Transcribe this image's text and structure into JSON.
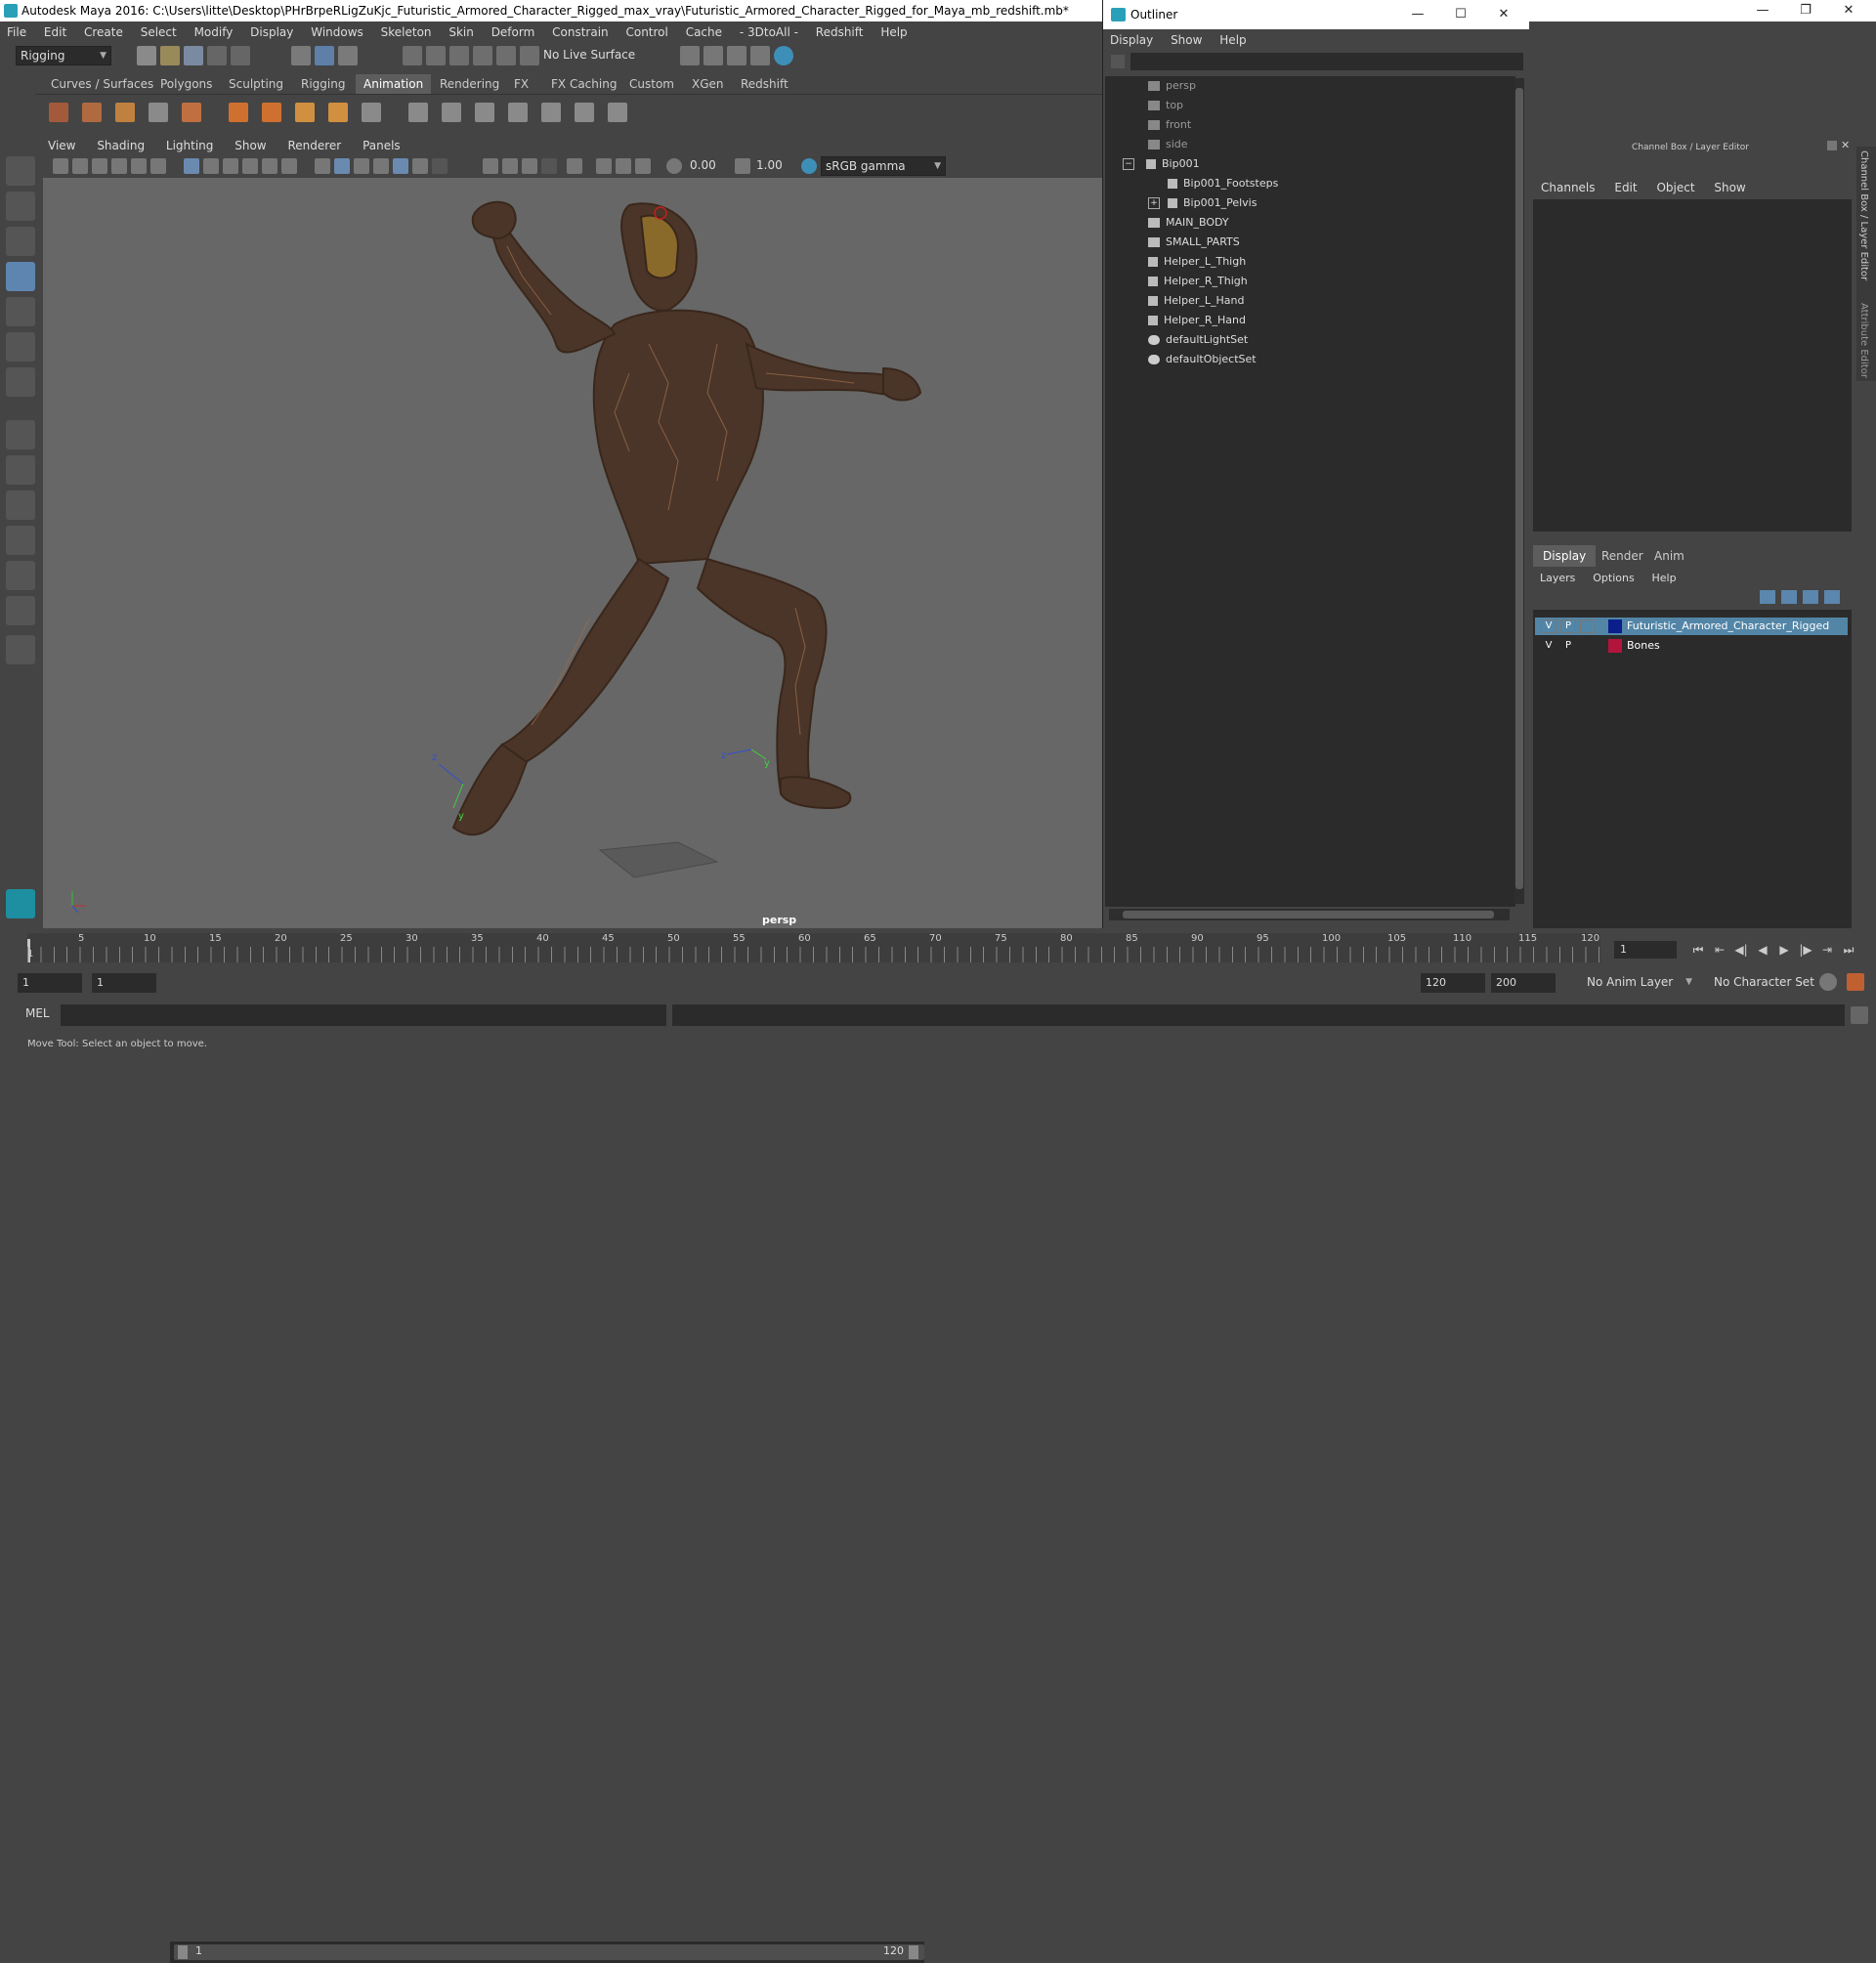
{
  "titlebar": {
    "title": "Autodesk Maya 2016: C:\\Users\\litte\\Desktop\\PHrBrpeRLigZuKjc_Futuristic_Armored_Character_Rigged_max_vray\\Futuristic_Armored_Character_Rigged_for_Maya_mb_redshift.mb*"
  },
  "menubar": [
    "File",
    "Edit",
    "Create",
    "Select",
    "Modify",
    "Display",
    "Windows",
    "Skeleton",
    "Skin",
    "Deform",
    "Constrain",
    "Control",
    "Cache",
    "- 3DtoAll -",
    "Redshift",
    "Help"
  ],
  "toolbar": {
    "mode": "Rigging",
    "live_surface": "No Live Surface"
  },
  "shelf_tabs": [
    "Curves / Surfaces",
    "Polygons",
    "Sculpting",
    "Rigging",
    "Animation",
    "Rendering",
    "FX",
    "FX Caching",
    "Custom",
    "XGen",
    "Redshift"
  ],
  "shelf_active": "Animation",
  "viewport_menu": [
    "View",
    "Shading",
    "Lighting",
    "Show",
    "Renderer",
    "Panels"
  ],
  "viewport_toolbar": {
    "exposure": "0.00",
    "gamma": "1.00",
    "colorspace": "sRGB gamma"
  },
  "viewport": {
    "camera_label": "persp"
  },
  "outliner": {
    "title": "Outliner",
    "menu": [
      "Display",
      "Show",
      "Help"
    ],
    "items": [
      "persp",
      "top",
      "front",
      "side",
      "Bip001",
      "Bip001_Footsteps",
      "Bip001_Pelvis",
      "MAIN_BODY",
      "SMALL_PARTS",
      "Helper_L_Thigh",
      "Helper_R_Thigh",
      "Helper_L_Hand",
      "Helper_R_Hand",
      "defaultLightSet",
      "defaultObjectSet"
    ]
  },
  "channel_box": {
    "title": "Channel Box / Layer Editor",
    "menu": [
      "Channels",
      "Edit",
      "Object",
      "Show"
    ]
  },
  "layer_editor": {
    "tabs": [
      "Display",
      "Render",
      "Anim"
    ],
    "menu": [
      "Layers",
      "Options",
      "Help"
    ],
    "layers": [
      {
        "v": "V",
        "p": "P",
        "name": "Futuristic_Armored_Character_Rigged",
        "color": "#0a1e8c",
        "selected": true
      },
      {
        "v": "V",
        "p": "P",
        "name": "Bones",
        "color": "#b4143c",
        "selected": false
      }
    ]
  },
  "side_tabs": [
    "Channel Box / Layer Editor",
    "Attribute Editor"
  ],
  "timeline": {
    "ticks": [
      "1",
      "5",
      "10",
      "15",
      "20",
      "25",
      "30",
      "35",
      "40",
      "45",
      "50",
      "55",
      "60",
      "65",
      "70",
      "75",
      "80",
      "85",
      "90",
      "95",
      "100",
      "105",
      "110",
      "115",
      "120"
    ],
    "current_frame": "1"
  },
  "range": {
    "start": "1",
    "inner_start": "1",
    "slider_start": "1",
    "slider_end": "120",
    "end": "120",
    "max": "200",
    "anim_layer": "No Anim Layer",
    "char_set": "No Character Set"
  },
  "cmdline": {
    "label": "MEL"
  },
  "help": {
    "text": "Move Tool: Select an object to move."
  },
  "colors": {
    "bg": "#444444",
    "viewport": "#676767",
    "panel": "#2b2b2b",
    "accent": "#5285a6"
  }
}
